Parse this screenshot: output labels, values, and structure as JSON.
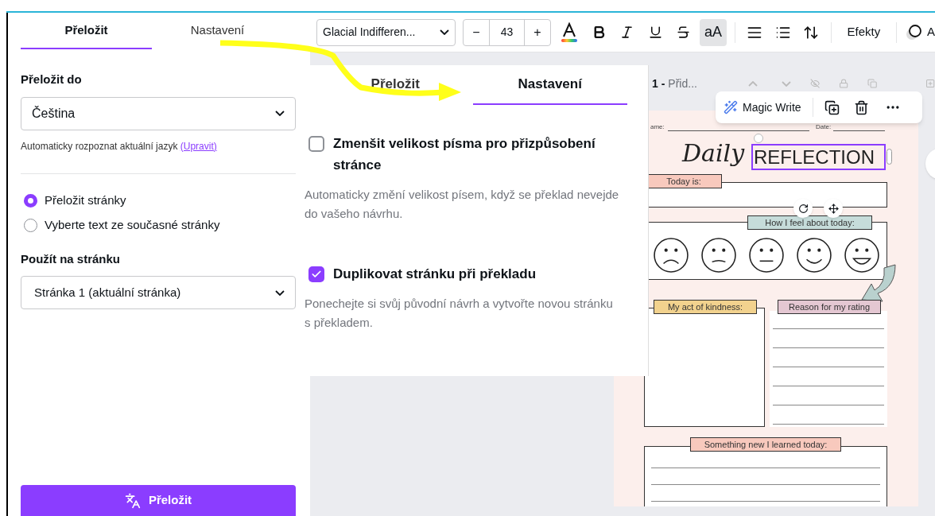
{
  "left_panel": {
    "tabs": [
      {
        "label": "Přeložit",
        "selected": true
      },
      {
        "label": "Nastavení",
        "selected": false
      }
    ],
    "translate_to": {
      "label": "Přeložit do",
      "value": "Čeština"
    },
    "detect_note": {
      "text": "Automaticky rozpoznat aktuální jazyk",
      "link": "(Upravit)"
    },
    "scope_options": [
      {
        "label": "Přeložit stránky",
        "selected": true
      },
      {
        "label": "Vyberte text ze současné stránky",
        "selected": false
      }
    ],
    "apply_to": {
      "label": "Použít na stránku",
      "value": "Stránka 1 (aktuální stránka)"
    },
    "translate_button": "Přeložit"
  },
  "toolbar": {
    "font": "Glacial Indifferen...",
    "decrease": "−",
    "font_size": "43",
    "increase": "+",
    "case_toggle": {
      "label": "aA",
      "on": true
    },
    "effects": "Efekty",
    "cut_label": "A"
  },
  "page_header": {
    "number": "1 -",
    "title": "Přid..."
  },
  "context_toolbar": {
    "magic_write": "Magic Write"
  },
  "design": {
    "name_label": "ame:",
    "date_label": "Date:",
    "title_script": "Daily",
    "title_text": "REFLECTION",
    "today_label": "Today is:",
    "feel_label": "How I feel about today:",
    "kindness_label": "My act of kindness:",
    "reason_label": "Reason for my rating",
    "learned_label": "Something new I learned today:"
  },
  "inset": {
    "tabs": [
      {
        "label": "Přeložit",
        "selected": false
      },
      {
        "label": "Nastavení",
        "selected": true
      }
    ],
    "options": [
      {
        "label": "Zmenšit velikost písma pro přizpůsobení stránce",
        "checked": false,
        "description": "Automaticky změní velikost písem, když se překlad nevejde do vašeho návrhu."
      },
      {
        "label": "Duplikovat stránku při překladu",
        "checked": true,
        "description": "Ponechejte si svůj původní návrh a vytvořte novou stránku s překladem."
      }
    ]
  }
}
